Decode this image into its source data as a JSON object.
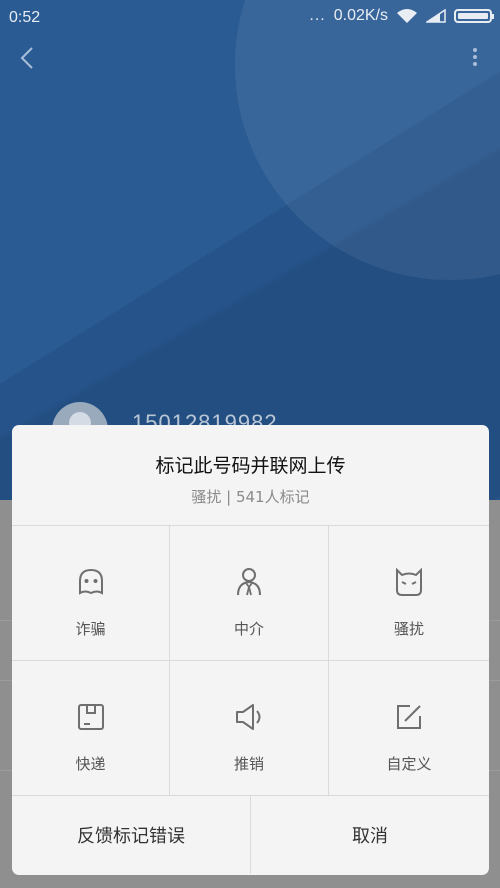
{
  "status_bar": {
    "time": "0:52",
    "dots": "...",
    "network_speed": "0.02K/s"
  },
  "contact": {
    "number": "15012819982"
  },
  "dialog": {
    "title": "标记此号码并联网上传",
    "subtitle": "骚扰 | 541人标记",
    "options": [
      {
        "label": "诈骗",
        "icon": "scam-face-icon"
      },
      {
        "label": "中介",
        "icon": "agent-person-icon"
      },
      {
        "label": "骚扰",
        "icon": "harass-devil-icon"
      },
      {
        "label": "快递",
        "icon": "delivery-box-icon"
      },
      {
        "label": "推销",
        "icon": "megaphone-icon"
      },
      {
        "label": "自定义",
        "icon": "edit-icon"
      }
    ],
    "feedback_label": "反馈标记错误",
    "cancel_label": "取消"
  },
  "colors": {
    "header_blue": "#2a5b93",
    "dialog_bg": "#f4f4f4",
    "icon_gray": "#6f6f6f"
  }
}
